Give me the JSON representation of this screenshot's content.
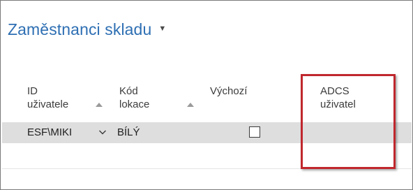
{
  "page": {
    "title": "Zaměstnanci skladu",
    "title_menu_icon": "caret-down-icon"
  },
  "columns": [
    {
      "line1": "ID",
      "line2": "uživatele",
      "sort_icon": "sort-up-icon"
    },
    {
      "line1": "Kód",
      "line2": "lokace",
      "sort_icon": "sort-up-icon"
    },
    {
      "line1": "Výchozí",
      "line2": ""
    },
    {
      "line1": "ADCS",
      "line2": "uživatel"
    }
  ],
  "rows": [
    {
      "user_id": "ESF\\MIKI",
      "location_code": "BÍLÝ",
      "default": false,
      "adcs_user": ""
    }
  ],
  "icons": {
    "dropdown": "chevron-down-icon",
    "checkbox": "checkbox-icon"
  },
  "colors": {
    "title": "#2e6fb3",
    "selected_row": "#dedede",
    "highlight_box": "#c0272d"
  }
}
